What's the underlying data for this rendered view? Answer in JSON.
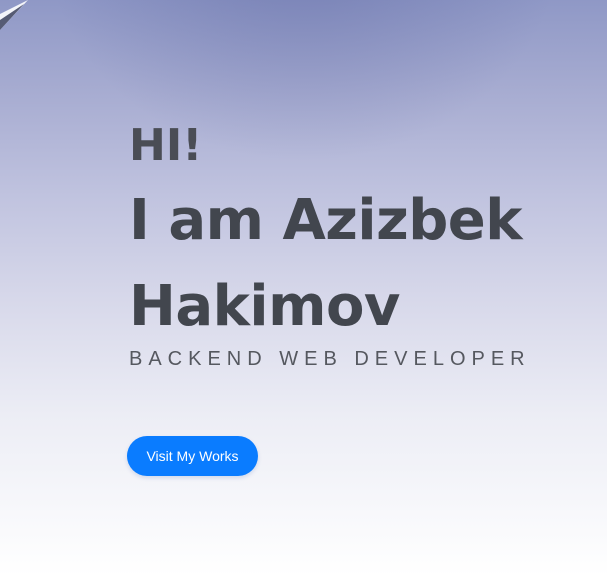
{
  "hero": {
    "greeting": "HI!",
    "name_line1": "I am Azizbek",
    "name_line2": "Hakimov",
    "role": "BACKEND WEB DEVELOPER",
    "cta_label": "Visit My Works"
  },
  "colors": {
    "accent": "#0a7cff",
    "heading": "#42464e",
    "subtitle": "#55585f"
  }
}
